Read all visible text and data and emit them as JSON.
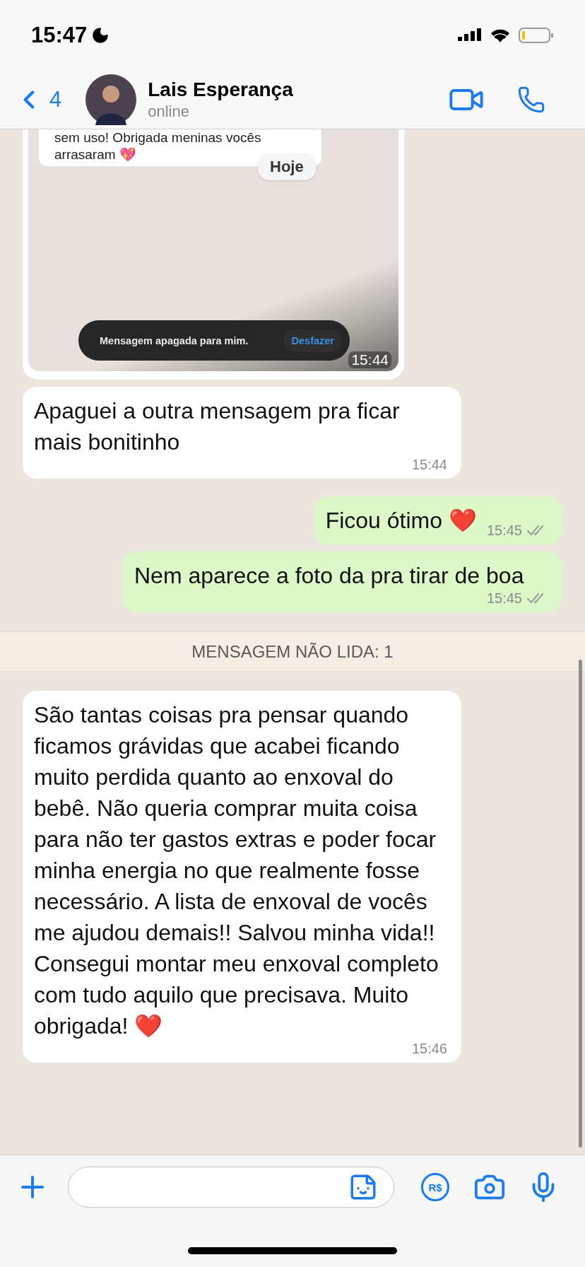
{
  "status_bar": {
    "time": "15:47"
  },
  "header": {
    "back_count": "4",
    "contact_name": "Lais Esperança",
    "status": "online"
  },
  "messages": [
    {
      "kind": "image",
      "outgoing": false,
      "time": "15:44",
      "screenshot": {
        "bubble_lines": [
          "sem uso! Obrigada meninas vocês",
          "arrasaram 💖"
        ],
        "date_chip": "Hoje",
        "toast": {
          "text": "Mensagem apagada para mim.",
          "action": "Desfazer"
        }
      }
    },
    {
      "kind": "text",
      "outgoing": false,
      "text": "Apaguei a outra mensagem pra ficar mais bonitinho",
      "time": "15:44"
    },
    {
      "kind": "text",
      "outgoing": true,
      "text": "Ficou ótimo ❤️",
      "time": "15:45",
      "read": false
    },
    {
      "kind": "text",
      "outgoing": true,
      "text": "Nem aparece a foto da pra tirar de boa",
      "time": "15:45",
      "read": false
    },
    {
      "kind": "divider",
      "text": "MENSAGEM NÃO LIDA: 1"
    },
    {
      "kind": "text",
      "outgoing": false,
      "text": "São tantas coisas pra pensar quando ficamos grávidas que acabei ficando muito perdida quanto ao enxoval do bebê. Não queria comprar muita coisa para não ter gastos extras e poder focar minha energia no que realmente fosse necessário. A lista de enxoval de vocês me ajudou demais!! Salvou minha vida!!\nConsegui montar meu enxoval completo com tudo aquilo que precisava. Muito obrigada! ❤️",
      "time": "15:46"
    }
  ],
  "composer": {
    "currency_symbol": "R$"
  }
}
